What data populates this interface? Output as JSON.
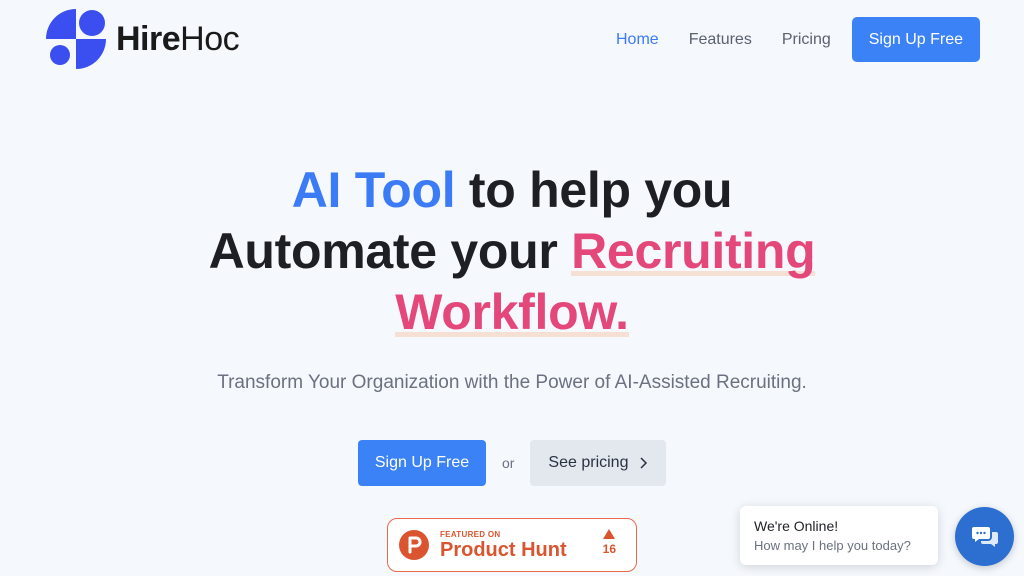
{
  "brand": {
    "name_bold": "Hire",
    "name_regular": "Hoc",
    "logo_color": "#3b4ef0"
  },
  "nav": {
    "items": [
      {
        "label": "Home",
        "active": true
      },
      {
        "label": "Features",
        "active": false
      },
      {
        "label": "Pricing",
        "active": false
      }
    ],
    "cta_label": "Sign Up Free"
  },
  "hero": {
    "title_blue": "AI Tool",
    "title_line1_rest": " to help you",
    "title_line2_prefix": "Automate your ",
    "title_pink1": "Recruiting",
    "title_pink2": "Workflow.",
    "subtitle": "Transform Your Organization with the Power of AI-Assisted Recruiting.",
    "primary_cta": "Sign Up Free",
    "or_text": "or",
    "secondary_cta": "See pricing"
  },
  "product_hunt": {
    "featured_on": "FEATURED ON",
    "name": "Product Hunt",
    "votes": "16",
    "color": "#da552f"
  },
  "chat": {
    "title": "We're Online!",
    "subtitle": "How may I help you today?",
    "icon": "chat-bubbles-icon"
  },
  "colors": {
    "accent_blue": "#3b82f6",
    "accent_pink": "#e4477a",
    "background": "#f5f8fd"
  }
}
